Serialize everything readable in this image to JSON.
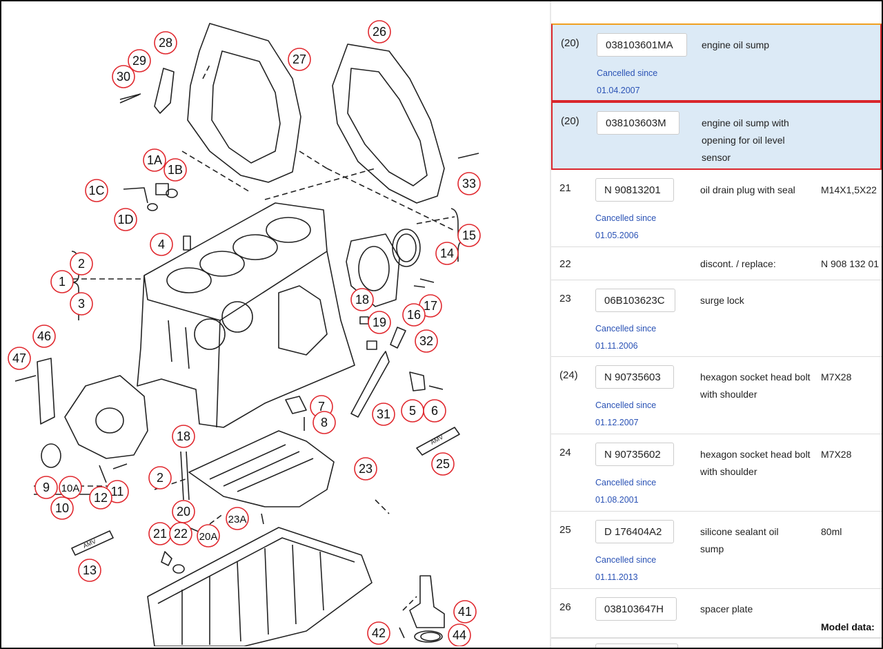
{
  "callouts": [
    "26",
    "27",
    "28",
    "29",
    "30",
    "1A",
    "1B",
    "1C",
    "1D",
    "33",
    "4",
    "15",
    "14",
    "2",
    "1",
    "3",
    "18",
    "17",
    "16",
    "19",
    "32",
    "46",
    "47",
    "5",
    "6",
    "7",
    "8",
    "31",
    "25",
    "18",
    "23",
    "9",
    "10A",
    "11",
    "12",
    "10",
    "2",
    "20",
    "23A",
    "21",
    "22",
    "20A",
    "13",
    "41",
    "42",
    "44"
  ],
  "tube_label": "AMV",
  "parts": [
    {
      "pos": "(20)",
      "pn": "038103601MA",
      "cancel_label": "Cancelled since",
      "cancel_date": "01.04.2007",
      "desc": "engine oil sump",
      "spec": ""
    },
    {
      "pos": "(20)",
      "pn": "038103603M",
      "cancel_label": "",
      "cancel_date": "",
      "desc": "engine oil sump with opening for oil level sensor",
      "spec": ""
    },
    {
      "pos": "21",
      "pn": "N 90813201",
      "cancel_label": "Cancelled since",
      "cancel_date": "01.05.2006",
      "desc": "oil drain plug with seal",
      "spec": "M14X1,5X22"
    },
    {
      "pos": "22",
      "pn": "",
      "cancel_label": "",
      "cancel_date": "",
      "desc": "discont. / replace:",
      "spec": "N 908 132 01"
    },
    {
      "pos": "23",
      "pn": "06B103623C",
      "cancel_label": "Cancelled since",
      "cancel_date": "01.11.2006",
      "desc": "surge lock",
      "spec": ""
    },
    {
      "pos": "(24)",
      "pn": "N 90735603",
      "cancel_label": "Cancelled since",
      "cancel_date": "01.12.2007",
      "desc": "hexagon socket head bolt with shoulder",
      "spec": "M7X28"
    },
    {
      "pos": "24",
      "pn": "N 90735602",
      "cancel_label": "Cancelled since",
      "cancel_date": "01.08.2001",
      "desc": "hexagon socket head bolt with shoulder",
      "spec": "M7X28"
    },
    {
      "pos": "25",
      "pn": "D 176404A2",
      "cancel_label": "Cancelled since",
      "cancel_date": "01.11.2013",
      "desc": "silicone sealant oil sump",
      "spec": "80ml"
    },
    {
      "pos": "26",
      "pn": "038103647H",
      "cancel_label": "",
      "cancel_date": "",
      "desc": "spacer plate",
      "spec": ""
    }
  ],
  "model_label": "Model data:"
}
